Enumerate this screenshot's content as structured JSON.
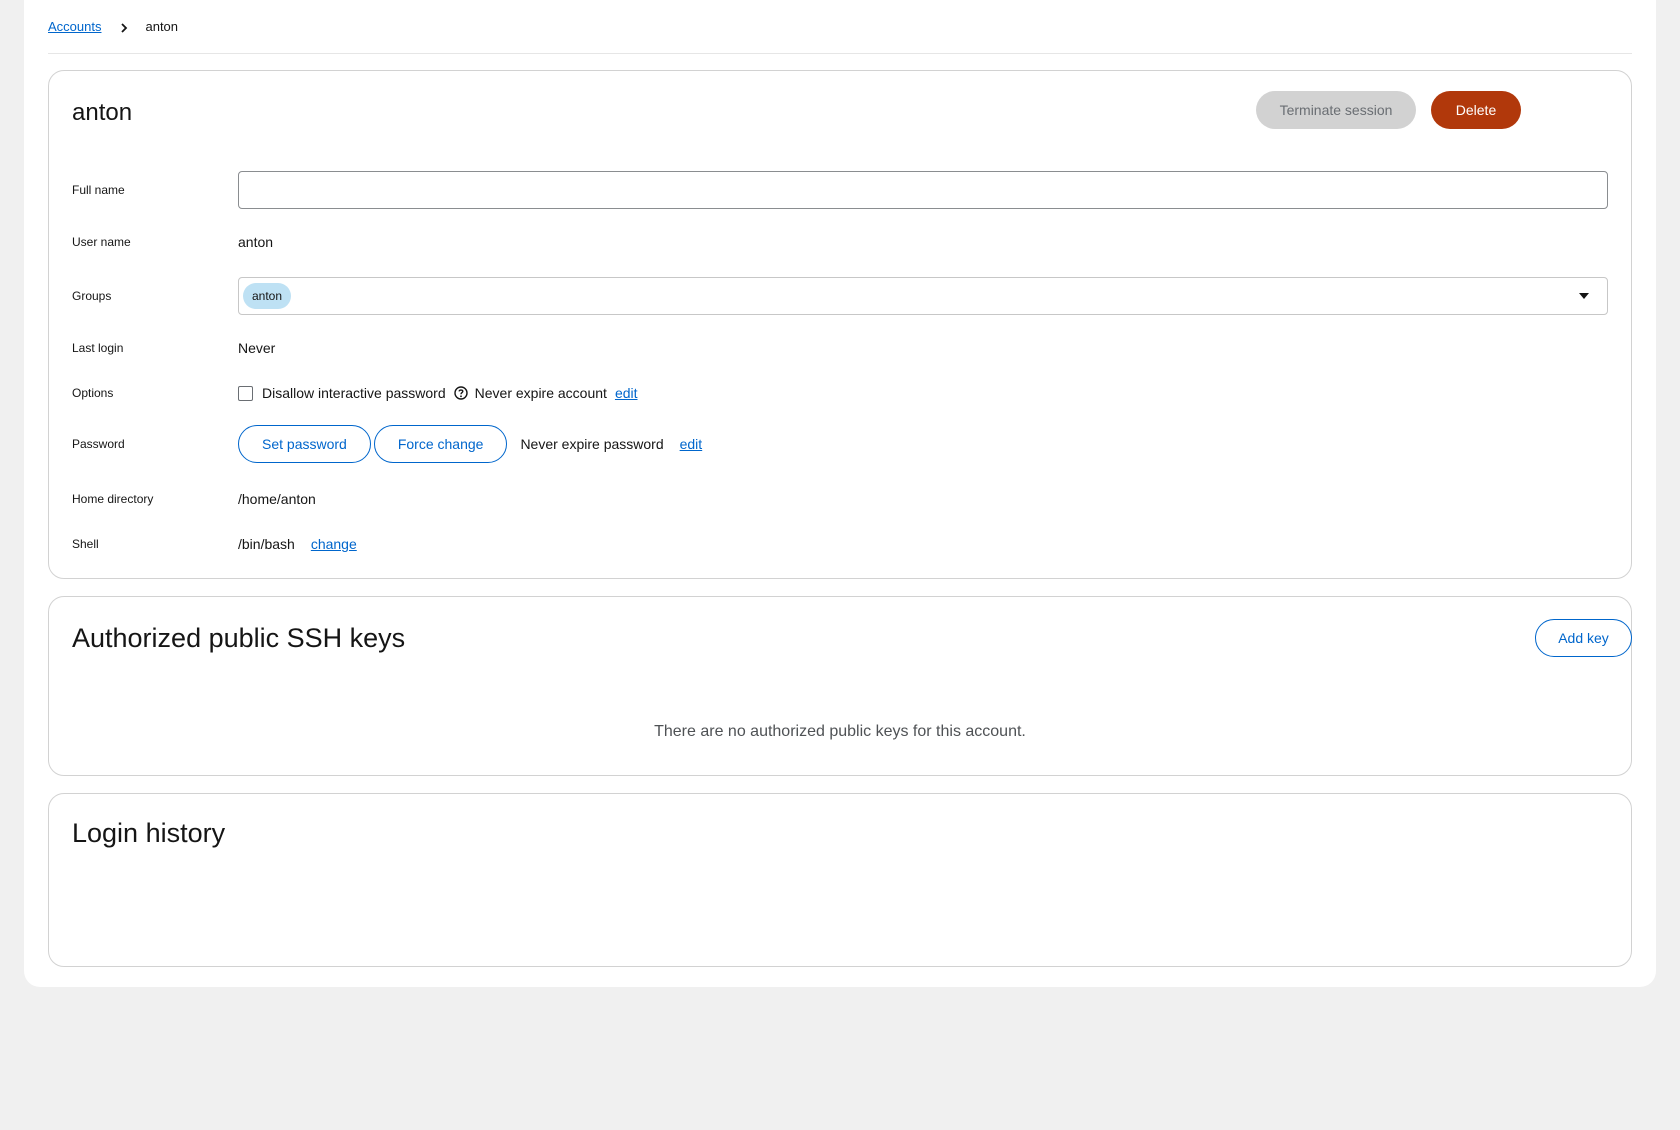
{
  "breadcrumb": {
    "parent": "Accounts",
    "current": "anton"
  },
  "account": {
    "title": "anton",
    "terminate_label": "Terminate session",
    "delete_label": "Delete",
    "fields": {
      "full_name_label": "Full name",
      "full_name_value": "",
      "user_name_label": "User name",
      "user_name_value": "anton",
      "groups_label": "Groups",
      "groups": [
        "anton"
      ],
      "last_login_label": "Last login",
      "last_login_value": "Never",
      "options_label": "Options",
      "disallow_password_label": "Disallow interactive password",
      "disallow_password_checked": false,
      "never_expire_account": "Never expire account",
      "options_edit": "edit",
      "password_label": "Password",
      "set_password": "Set password",
      "force_change": "Force change",
      "never_expire_password": "Never expire password",
      "password_edit": "edit",
      "home_label": "Home directory",
      "home_value": "/home/anton",
      "shell_label": "Shell",
      "shell_value": "/bin/bash",
      "shell_change": "change"
    }
  },
  "ssh": {
    "title": "Authorized public SSH keys",
    "add_key": "Add key",
    "empty_message": "There are no authorized public keys for this account."
  },
  "history": {
    "title": "Login history"
  },
  "colors": {
    "accent": "#0066cc",
    "danger": "#b1380b",
    "chip": "#bee1f4",
    "disabled": "#d2d2d2"
  }
}
